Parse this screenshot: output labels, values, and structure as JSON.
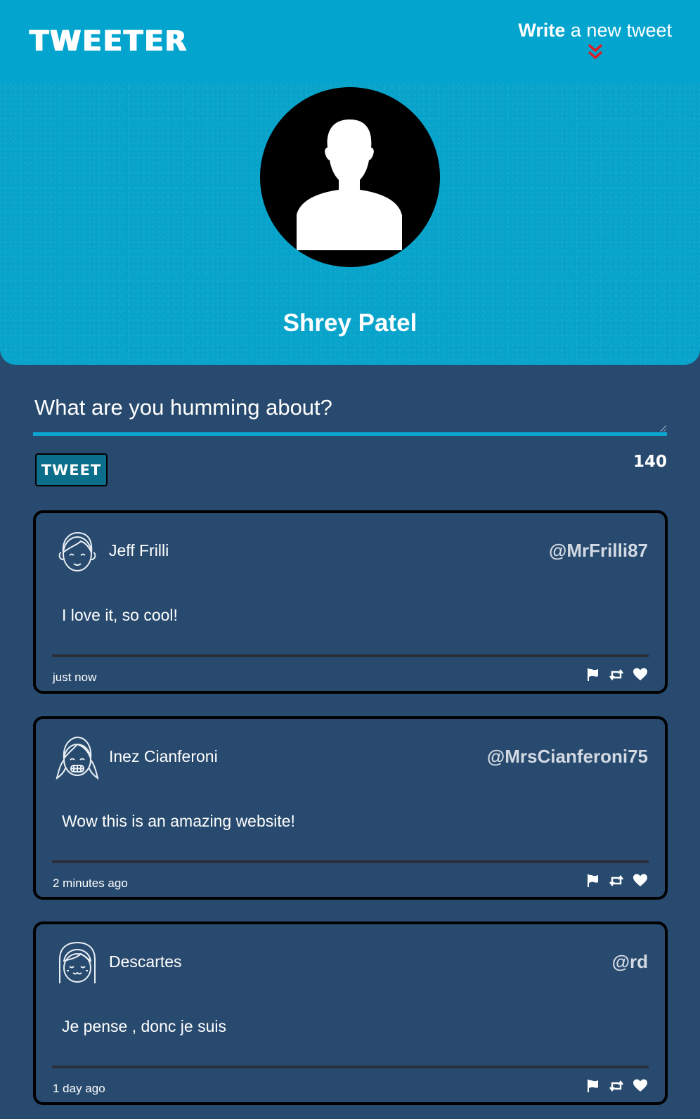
{
  "header": {
    "brand": "TWEETER",
    "compose_toggle_strong": "Write",
    "compose_toggle_rest": " a new tweet",
    "compose_toggle_icon": "double-chevron-down-icon",
    "chevron_color": "#e01b22",
    "profile_name": "Shrey Patel",
    "avatar_icon": "user-silhouette-icon"
  },
  "compose": {
    "placeholder": "What are you humming about?",
    "value": "",
    "tweet_button_label": "TWEET",
    "char_counter": "140"
  },
  "tweets": [
    {
      "name": "Jeff Frilli",
      "handle": "@MrFrilli87",
      "content": "I love it, so cool!",
      "time": "just now",
      "avatar_icon": "boy-face-icon"
    },
    {
      "name": "Inez Cianferoni",
      "handle": "@MrsCianferoni75",
      "content": "Wow this is an amazing website!",
      "time": "2 minutes ago",
      "avatar_icon": "girl-braces-face-icon"
    },
    {
      "name": "Descartes",
      "handle": "@rd",
      "content": "Je pense , donc je suis",
      "time": "1 day ago",
      "avatar_icon": "girl-bangs-face-icon"
    }
  ],
  "actions": [
    "flag-icon",
    "retweet-icon",
    "heart-icon"
  ],
  "colors": {
    "header_bg": "#07a3ca",
    "page_bg": "#284a6e",
    "accent": "#0aa7d2",
    "tweet_button_bg": "#0b6f8c"
  }
}
